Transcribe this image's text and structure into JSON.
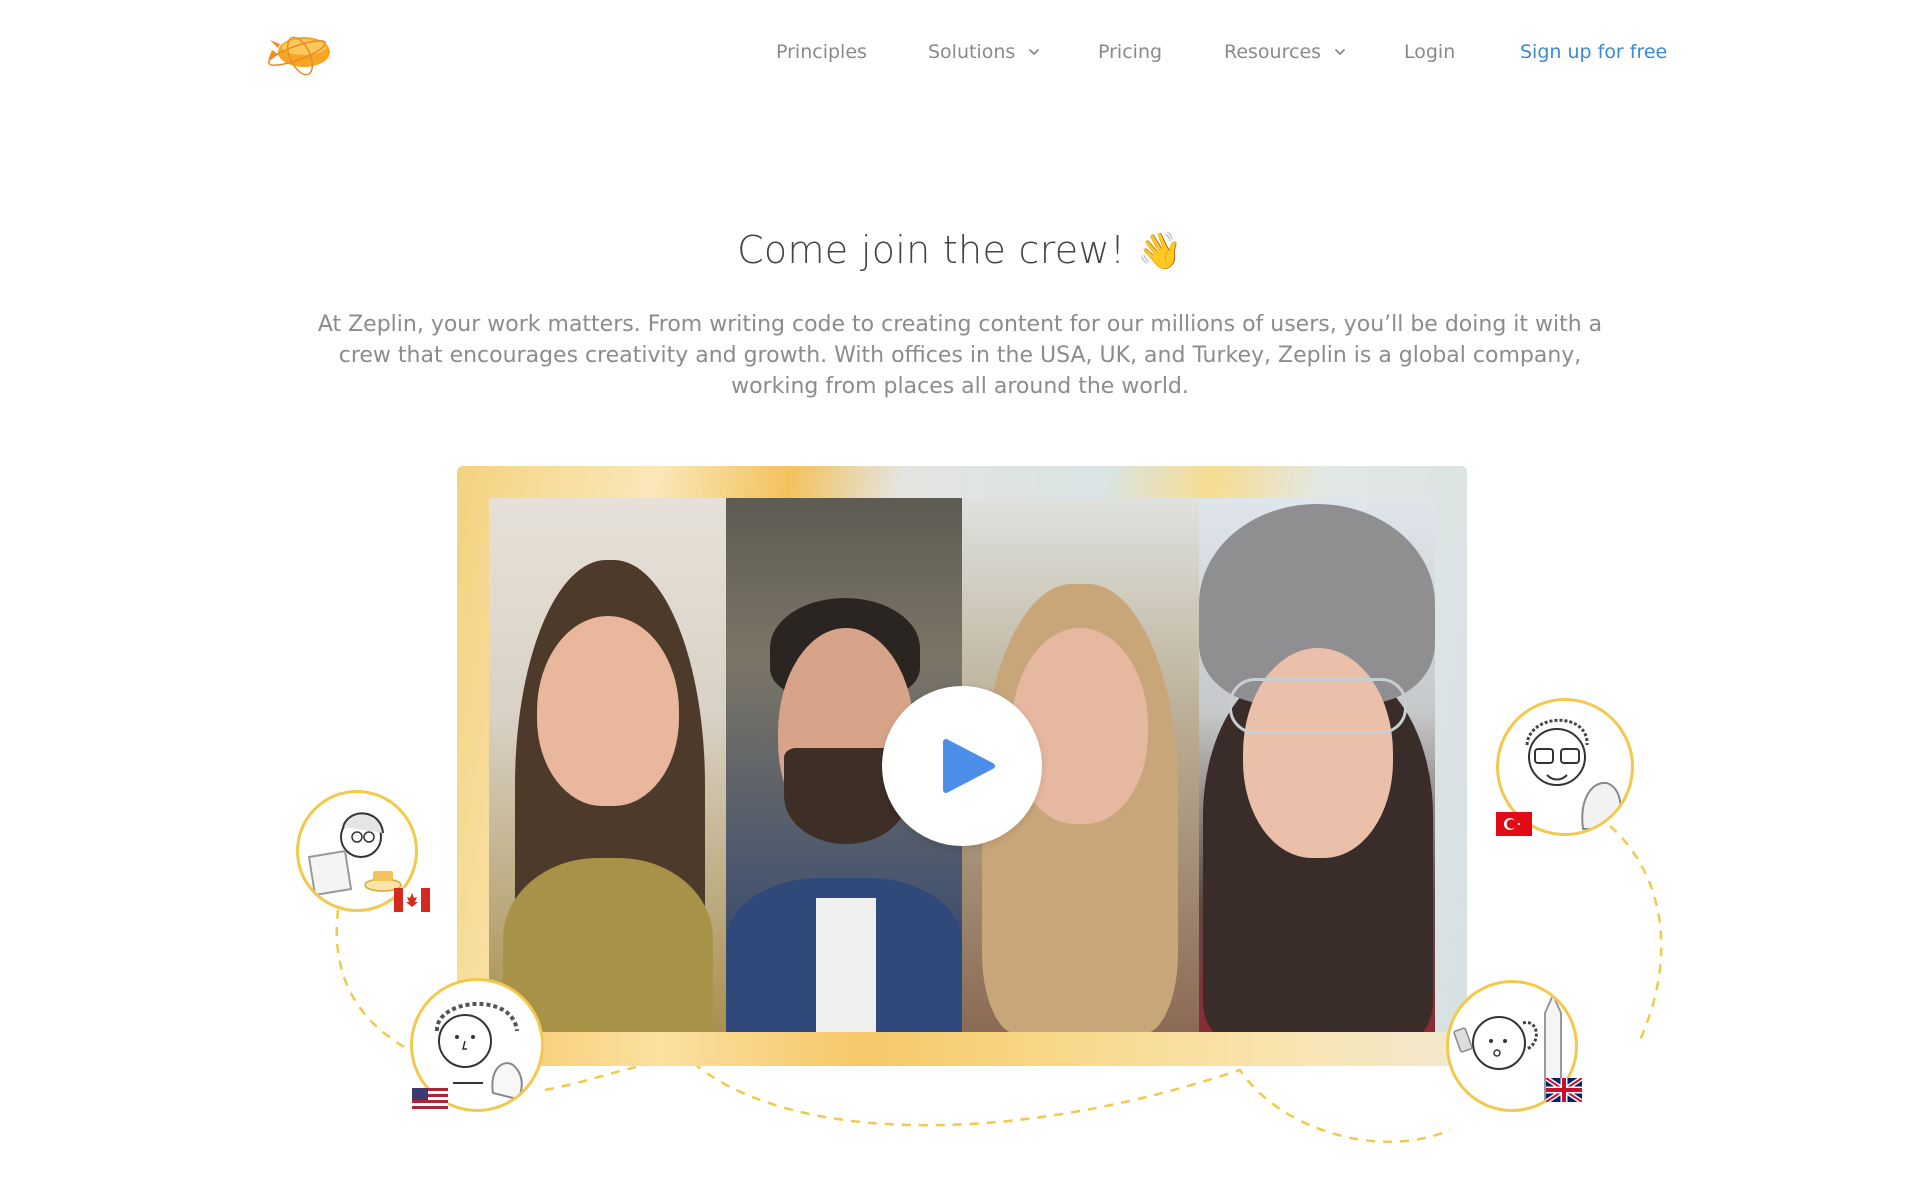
{
  "header": {
    "logo_alt": "Zeplin",
    "nav": [
      {
        "label": "Principles",
        "dropdown": false
      },
      {
        "label": "Solutions",
        "dropdown": true
      },
      {
        "label": "Pricing",
        "dropdown": false
      },
      {
        "label": "Resources",
        "dropdown": true
      },
      {
        "label": "Login",
        "dropdown": false
      }
    ],
    "signup_label": "Sign up for free"
  },
  "hero": {
    "title": "Come join the crew!",
    "title_emoji": "👋",
    "description": "At Zeplin, your work matters. From writing code to creating content for our millions of users, you’ll be doing it with a crew that encourages creativity and growth. With offices in the USA, UK, and Turkey, Zeplin is a global company, working from places all around the world."
  },
  "video": {
    "play_icon": "play-icon",
    "panels": 4
  },
  "avatars": [
    {
      "flag": "Canada",
      "icon": "canada-flag-icon"
    },
    {
      "flag": "USA",
      "icon": "usa-flag-icon"
    },
    {
      "flag": "Turkey",
      "icon": "turkey-flag-icon"
    },
    {
      "flag": "UK",
      "icon": "uk-flag-icon"
    }
  ],
  "colors": {
    "signup_link": "#3b88d6",
    "nav_text": "#8a8a8a",
    "accent_yellow": "#f2c94c",
    "play_triangle": "#4a8ee8"
  }
}
